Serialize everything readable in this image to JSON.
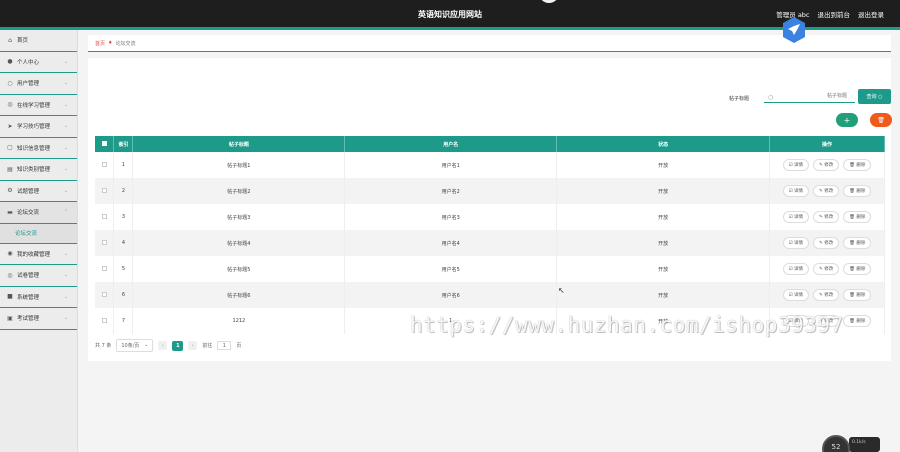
{
  "header": {
    "title": "英语知识应用网站",
    "links": [
      "管理员 abc",
      "退出到前台",
      "退出登录"
    ]
  },
  "sidebar": {
    "items": [
      {
        "label": "首页",
        "icon": "home-icon"
      },
      {
        "label": "个人中心",
        "icon": "user-icon"
      },
      {
        "label": "用户管理",
        "icon": "circle-icon"
      },
      {
        "label": "在线学习管理",
        "icon": "circle-icon"
      },
      {
        "label": "学习技巧管理",
        "icon": "send-icon"
      },
      {
        "label": "知识信息管理",
        "icon": "doc-icon"
      },
      {
        "label": "知识类别管理",
        "icon": "list-icon"
      },
      {
        "label": "试题管理",
        "icon": "gear-icon"
      },
      {
        "label": "论坛交流",
        "icon": "folder-icon"
      }
    ],
    "sub_item": "论坛交流",
    "items_after": [
      {
        "label": "我的收藏管理",
        "icon": "star-icon"
      },
      {
        "label": "试卷管理",
        "icon": "circle-icon"
      },
      {
        "label": "系统管理",
        "icon": "box-icon"
      },
      {
        "label": "考试管理",
        "icon": "doc-icon"
      }
    ]
  },
  "breadcrumb": {
    "home": "首页",
    "current": "论坛交流"
  },
  "search": {
    "label": "帖子标题",
    "placeholder": "帖子标题",
    "button": "查询"
  },
  "actions": {
    "add": "+",
    "delete": "🗑"
  },
  "table": {
    "headers": [
      "索引",
      "帖子标题",
      "用户名",
      "状态",
      "操作"
    ],
    "rows": [
      {
        "idx": "1",
        "title": "帖子标题1",
        "user": "用户名1",
        "status": "开放"
      },
      {
        "idx": "2",
        "title": "帖子标题2",
        "user": "用户名2",
        "status": "开放"
      },
      {
        "idx": "3",
        "title": "帖子标题3",
        "user": "用户名3",
        "status": "开放"
      },
      {
        "idx": "4",
        "title": "帖子标题4",
        "user": "用户名4",
        "status": "开放"
      },
      {
        "idx": "5",
        "title": "帖子标题5",
        "user": "用户名5",
        "status": "开放"
      },
      {
        "idx": "6",
        "title": "帖子标题6",
        "user": "用户名6",
        "status": "开放"
      },
      {
        "idx": "7",
        "title": "1212",
        "user": "1",
        "status": "开放"
      }
    ],
    "op_labels": [
      "详情",
      "修改",
      "删除"
    ]
  },
  "pager": {
    "total": "共 7 条",
    "page_size": "10条/页",
    "current_page": "1",
    "goto_prefix": "前往",
    "goto_value": "1",
    "goto_suffix": "页"
  },
  "watermark": "https://www.huzhan.com/ishop39397",
  "corner_widget": {
    "percent": "52",
    "text": "0.1k/s"
  },
  "colors": {
    "accent": "#1d9a8a",
    "topbar": "#1e1e1e",
    "danger": "#f05a1a",
    "add": "#20a07a"
  }
}
